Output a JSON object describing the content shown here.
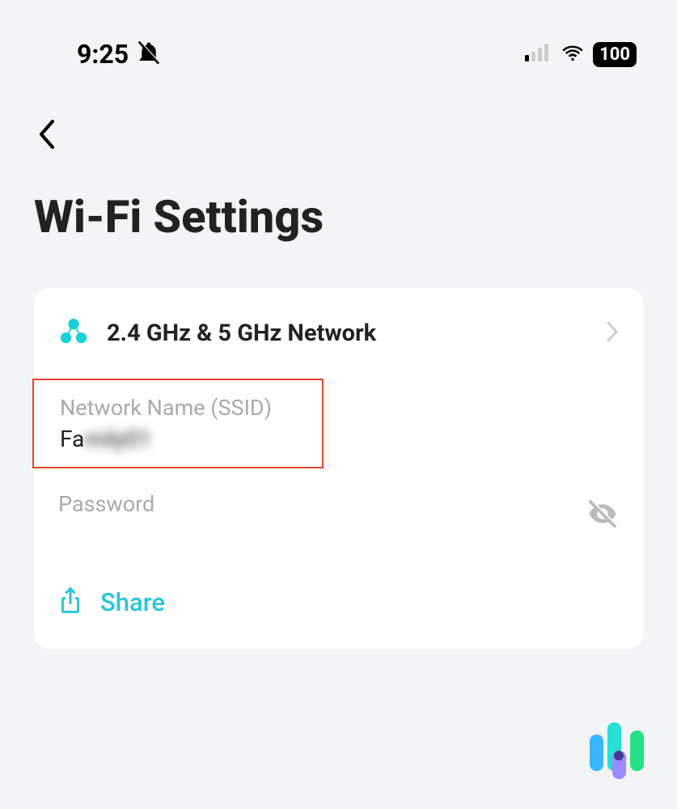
{
  "status_bar": {
    "time": "9:25",
    "battery": "100"
  },
  "page": {
    "title": "Wi-Fi Settings"
  },
  "network": {
    "label": "2.4 GHz & 5 GHz Network"
  },
  "ssid": {
    "label": "Network Name (SSID)",
    "value_prefix": "Fa",
    "value_blurred": "mily01"
  },
  "password": {
    "label": "Password"
  },
  "share": {
    "label": "Share"
  }
}
